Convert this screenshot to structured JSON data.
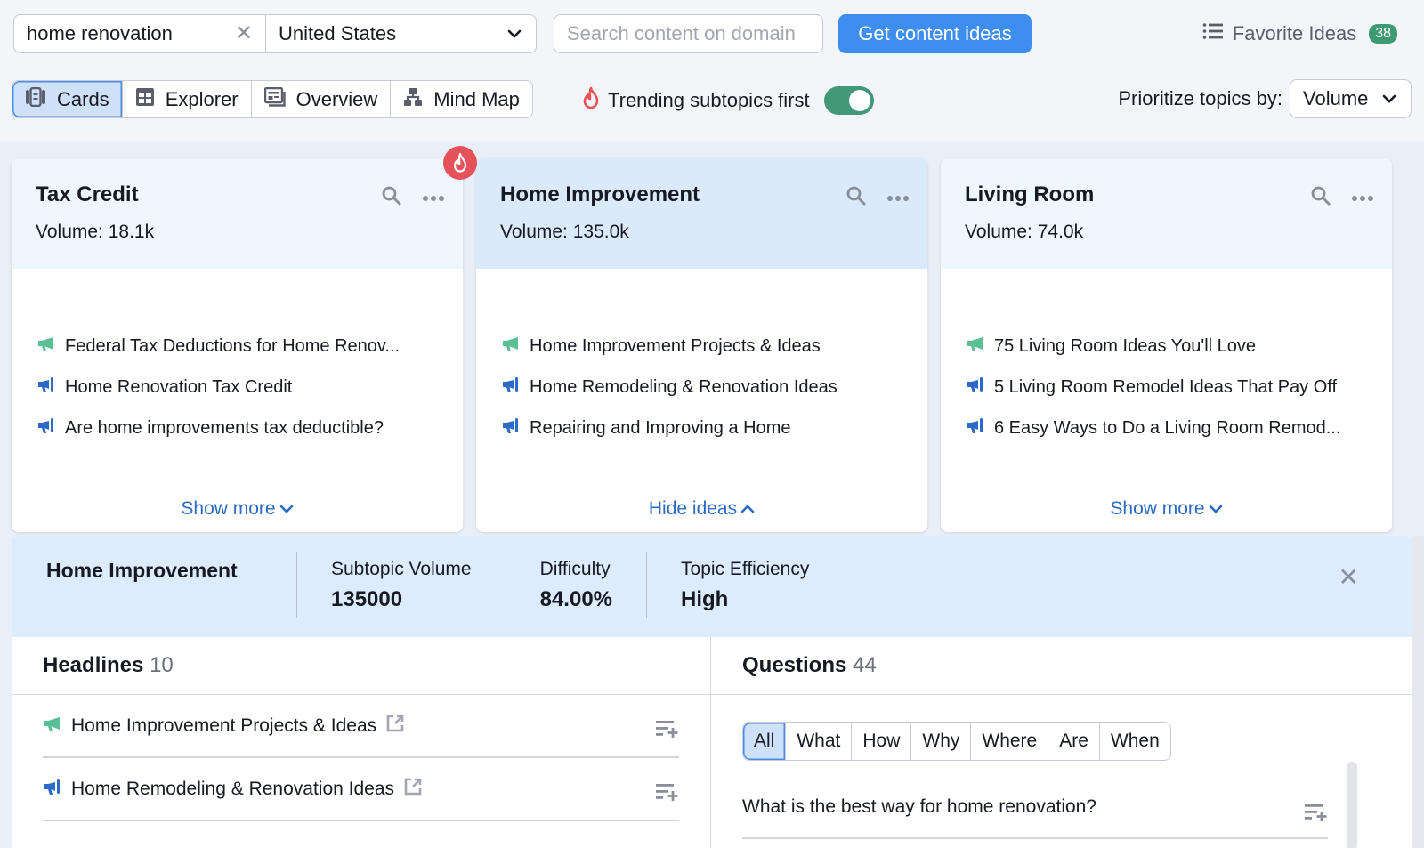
{
  "search": {
    "keyword_value": "home renovation",
    "country_value": "United States",
    "domain_placeholder": "Search content on domain",
    "submit_label": "Get content ideas"
  },
  "favorites": {
    "label": "Favorite Ideas",
    "count": "38",
    "icon": "list-icon"
  },
  "view_tabs": [
    {
      "label": "Cards",
      "icon": "cards-icon",
      "active": true
    },
    {
      "label": "Explorer",
      "icon": "table-icon",
      "active": false
    },
    {
      "label": "Overview",
      "icon": "overview-icon",
      "active": false
    },
    {
      "label": "Mind Map",
      "icon": "mindmap-icon",
      "active": false
    }
  ],
  "trending": {
    "label": "Trending subtopics first",
    "enabled": true
  },
  "prioritize": {
    "label": "Prioritize topics by:",
    "value": "Volume"
  },
  "colors": {
    "accent": "#3d8ef0",
    "toggle_on": "#43987a",
    "badge": "#3e9a73",
    "fire": "#e5525a",
    "link": "#2b6cc1",
    "megaphone_green": "#5bbf94",
    "megaphone_blue": "#2d6ac8"
  },
  "cards": [
    {
      "title": "Tax Credit",
      "volume_label": "Volume:",
      "volume": "18.1k",
      "trending": true,
      "ideas": [
        {
          "text": "Federal Tax Deductions for Home Renov...",
          "icon": "megaphone-green"
        },
        {
          "text": "Home Renovation Tax Credit",
          "icon": "megaphone-blue"
        },
        {
          "text": "Are home improvements tax deductible?",
          "icon": "megaphone-blue"
        }
      ],
      "toggle_label": "Show more"
    },
    {
      "title": "Home Improvement",
      "volume_label": "Volume:",
      "volume": "135.0k",
      "selected": true,
      "ideas": [
        {
          "text": "Home Improvement Projects & Ideas",
          "icon": "megaphone-green"
        },
        {
          "text": "Home Remodeling & Renovation Ideas",
          "icon": "megaphone-blue"
        },
        {
          "text": "Repairing and Improving a Home",
          "icon": "megaphone-blue"
        }
      ],
      "toggle_label": "Hide ideas"
    },
    {
      "title": "Living Room",
      "volume_label": "Volume:",
      "volume": "74.0k",
      "ideas": [
        {
          "text": "75 Living Room Ideas You'll Love",
          "icon": "megaphone-green"
        },
        {
          "text": "5 Living Room Remodel Ideas That Pay Off",
          "icon": "megaphone-blue"
        },
        {
          "text": "6 Easy Ways to Do a Living Room Remod...",
          "icon": "megaphone-blue"
        }
      ],
      "toggle_label": "Show more"
    }
  ],
  "detail": {
    "title": "Home Improvement",
    "metrics": [
      {
        "label": "Subtopic Volume",
        "value": "135000"
      },
      {
        "label": "Difficulty",
        "value": "84.00%"
      },
      {
        "label": "Topic Efficiency",
        "value": "High"
      }
    ],
    "headlines": {
      "label": "Headlines",
      "count": "10",
      "items": [
        {
          "text": "Home Improvement Projects & Ideas",
          "icon": "megaphone-green"
        },
        {
          "text": "Home Remodeling & Renovation Ideas",
          "icon": "megaphone-blue"
        }
      ]
    },
    "questions": {
      "label": "Questions",
      "count": "44",
      "filters": [
        "All",
        "What",
        "How",
        "Why",
        "Where",
        "Are",
        "When"
      ],
      "active_filter": "All",
      "items": [
        {
          "text": "What is the best way for home renovation?"
        }
      ]
    }
  }
}
